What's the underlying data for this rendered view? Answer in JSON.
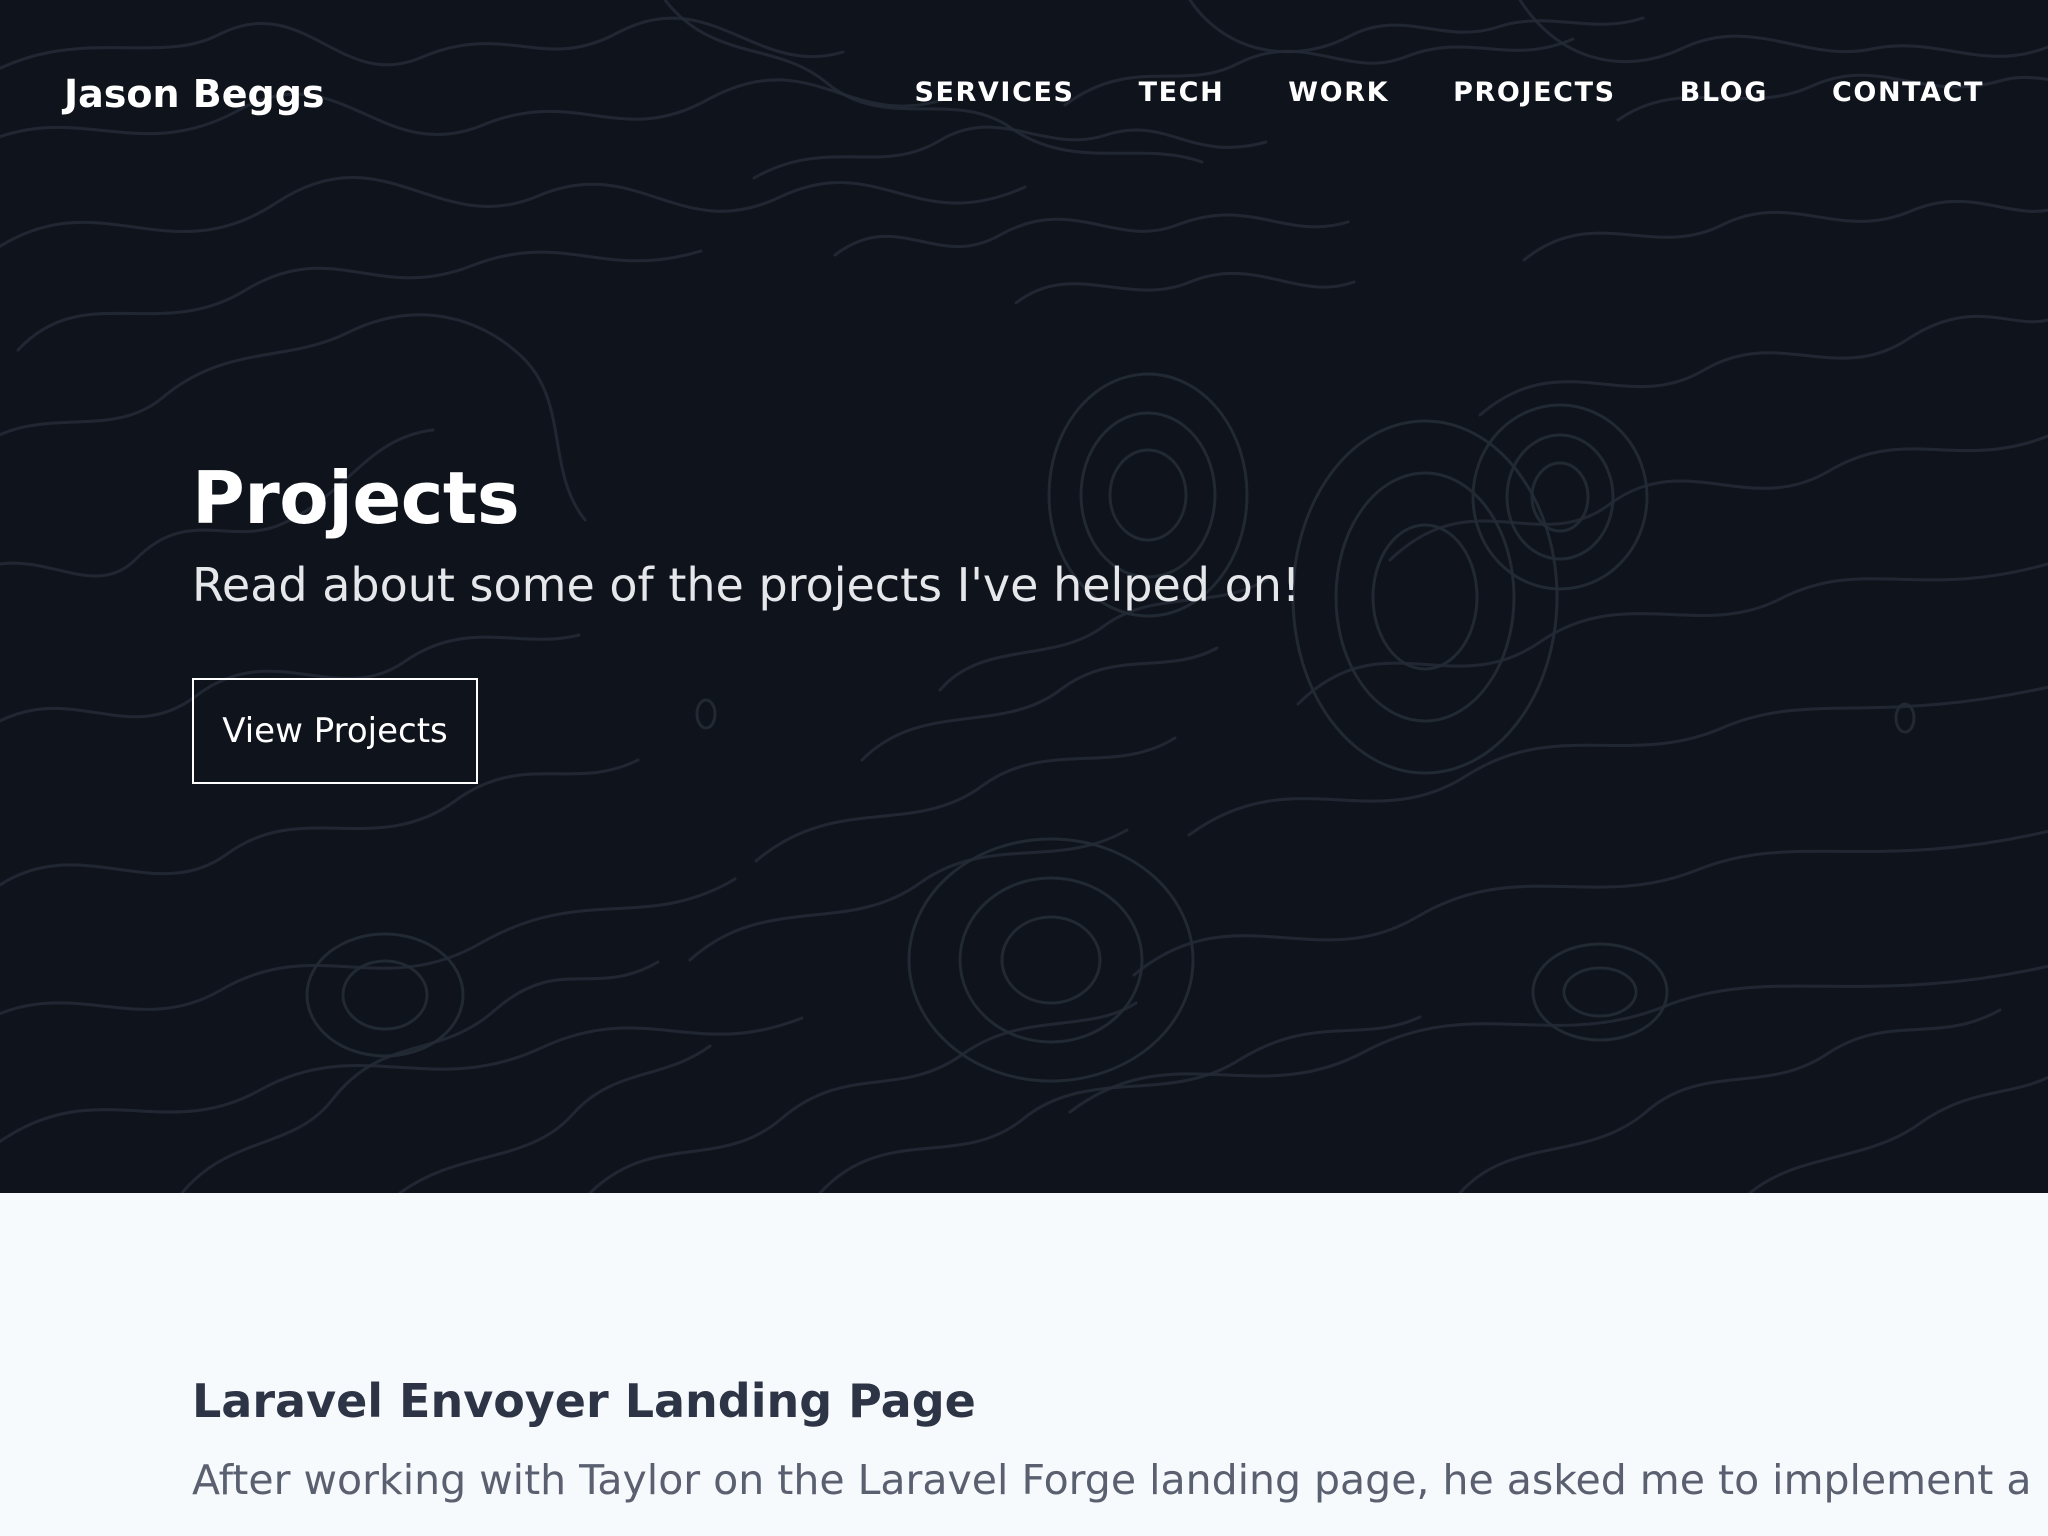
{
  "navigation": {
    "brand": "Jason Beggs",
    "items": [
      {
        "label": "SERVICES"
      },
      {
        "label": "TECH"
      },
      {
        "label": "WORK"
      },
      {
        "label": "PROJECTS"
      },
      {
        "label": "BLOG"
      },
      {
        "label": "CONTACT"
      }
    ]
  },
  "hero": {
    "title": "Projects",
    "subtitle": "Read about some of the projects I've helped on!",
    "button_label": "View Projects"
  },
  "project": {
    "title": "Laravel Envoyer Landing Page",
    "description": "After working with Taylor on the Laravel Forge landing page, he asked me to implement a"
  },
  "colors": {
    "hero_background": "#0f131c",
    "contour_line": "#232a35",
    "page_background": "#f7fafc",
    "heading_text": "#2d3446",
    "body_text": "#5a6070",
    "white": "#ffffff"
  }
}
